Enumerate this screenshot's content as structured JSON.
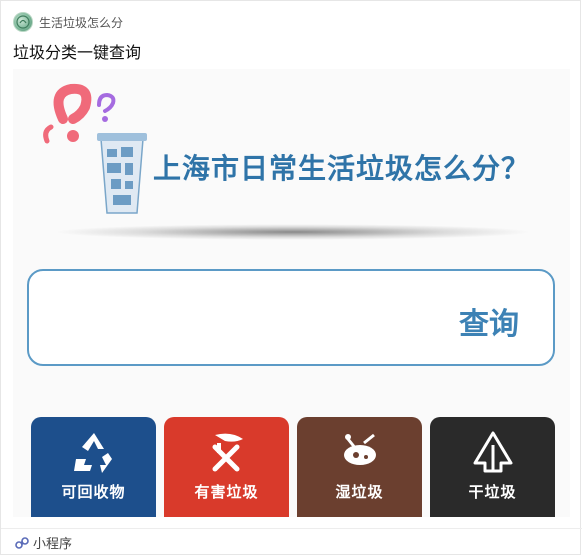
{
  "app": {
    "name": "生活垃圾怎么分",
    "logo_icon": "app-logo-icon"
  },
  "page": {
    "title": "垃圾分类一键查询"
  },
  "banner": {
    "headline": "上海市日常生活垃圾怎么分？",
    "question_marks_icon": "question-marks-icon",
    "cup_icon": "trash-cup-icon"
  },
  "search": {
    "button_label": "查询"
  },
  "categories": [
    {
      "label": "可回收物",
      "icon": "recycle-icon",
      "color": "#1d4f8c"
    },
    {
      "label": "有害垃圾",
      "icon": "hazardous-icon",
      "color": "#d93a2b"
    },
    {
      "label": "湿垃圾",
      "icon": "food-waste-icon",
      "color": "#6b3f2f"
    },
    {
      "label": "干垃圾",
      "icon": "residual-waste-icon",
      "color": "#2a2a2a"
    }
  ],
  "footer": {
    "label": "小程序",
    "icon": "mini-program-icon"
  },
  "colors": {
    "accent_blue": "#3d82b5",
    "border_blue": "#5b9ac6"
  }
}
